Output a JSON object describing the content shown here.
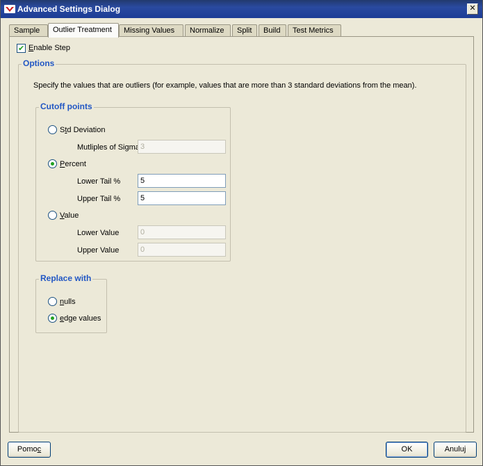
{
  "window": {
    "title": "Advanced Settings Dialog",
    "close_label": "✕"
  },
  "tabs": [
    {
      "label": "Sample",
      "active": false
    },
    {
      "label": "Outlier Treatment",
      "active": true
    },
    {
      "label": "Missing Values",
      "active": false
    },
    {
      "label": "Normalize",
      "active": false
    },
    {
      "label": "Split",
      "active": false
    },
    {
      "label": "Build",
      "active": false
    },
    {
      "label": "Test Metrics",
      "active": false
    }
  ],
  "enable_step": {
    "label_prefix": "",
    "label_mnemonic": "E",
    "label_rest": "nable Step",
    "checked": true
  },
  "options": {
    "legend": "Options",
    "description": "Specify the values that are outliers (for example, values that are more than 3 standard deviations from the mean)."
  },
  "cutoff": {
    "legend": "Cutoff points",
    "std_deviation": {
      "label_prefix": "S",
      "label_mnemonic": "t",
      "label_rest": "d Deviation",
      "selected": false
    },
    "sigma": {
      "label": "Mutliples of Sigma",
      "value": "3"
    },
    "percent": {
      "label_prefix": "",
      "label_mnemonic": "P",
      "label_rest": "ercent",
      "selected": true
    },
    "lower_tail": {
      "label": "Lower Tail %",
      "value": "5"
    },
    "upper_tail": {
      "label": "Upper Tail %",
      "value": "5"
    },
    "value": {
      "label_prefix": "",
      "label_mnemonic": "V",
      "label_rest": "alue",
      "selected": false
    },
    "lower_value": {
      "label": "Lower Value",
      "value": "0"
    },
    "upper_value": {
      "label": "Upper Value",
      "value": "0"
    }
  },
  "replace": {
    "legend": "Replace with",
    "nulls": {
      "label_prefix": "",
      "label_mnemonic": "n",
      "label_rest": "ulls",
      "selected": false
    },
    "edge": {
      "label_prefix": "",
      "label_mnemonic": "e",
      "label_rest": "dge values",
      "selected": true
    }
  },
  "buttons": {
    "help": {
      "label_prefix": "Pomo",
      "label_mnemonic": "c",
      "label_rest": ""
    },
    "ok": "OK",
    "cancel": "Anuluj"
  },
  "colors": {
    "accent": "#2257c4",
    "check": "#21a121",
    "title_bar": "#2a4aa0"
  }
}
